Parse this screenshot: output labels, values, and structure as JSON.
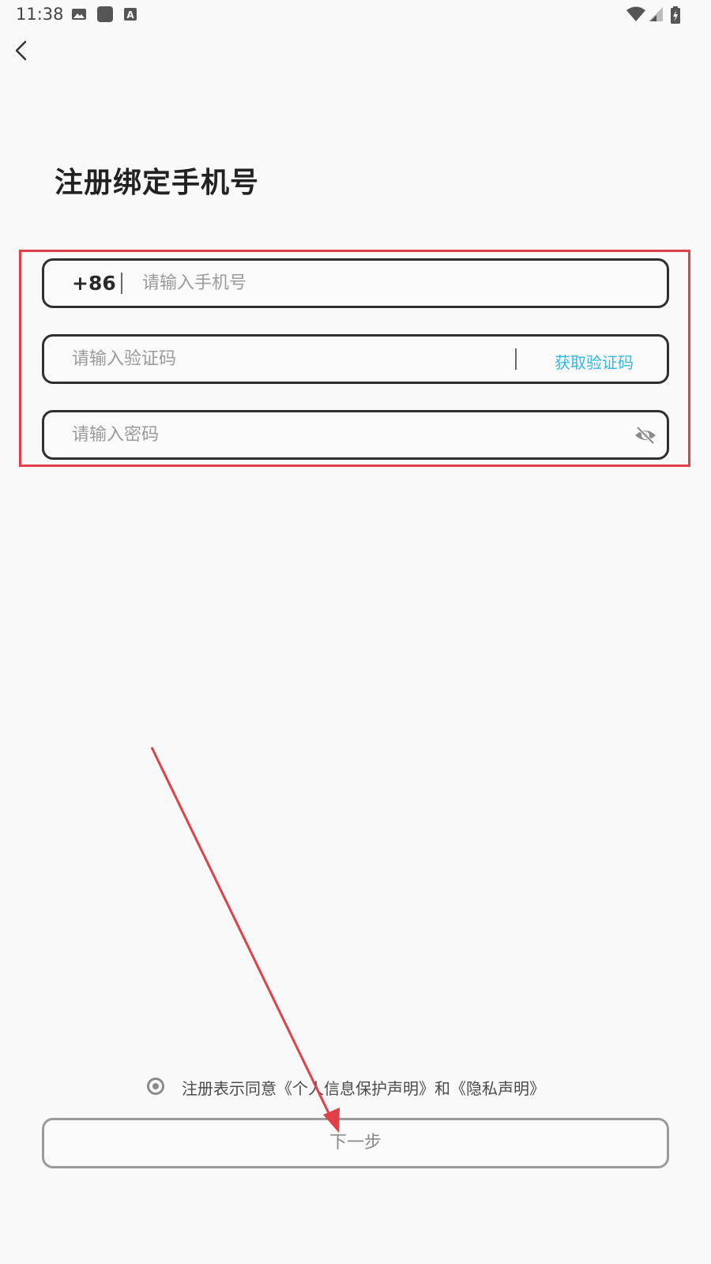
{
  "status_bar": {
    "time": "11:38",
    "icons": [
      "image-icon",
      "app-square-icon",
      "text-a-icon",
      "wifi-icon",
      "signal-icon",
      "battery-icon"
    ]
  },
  "nav": {
    "back_icon": "chevron-left-icon"
  },
  "page": {
    "title": "注册绑定手机号"
  },
  "form": {
    "phone": {
      "country_code": "+86",
      "placeholder": "请输入手机号",
      "value": ""
    },
    "code": {
      "placeholder": "请输入验证码",
      "value": "",
      "get_code_label": "获取验证码"
    },
    "password": {
      "placeholder": "请输入密码",
      "value": "",
      "toggle_icon": "eye-off-icon"
    }
  },
  "agreement": {
    "text": "注册表示同意《个人信息保护声明》和《隐私声明》",
    "checked": true
  },
  "next_button": {
    "label": "下一步"
  },
  "colors": {
    "background": "#f9f9f9",
    "accent_link": "#33b8e0",
    "annotation": "#e04048",
    "field_border": "#2f2f2f"
  }
}
